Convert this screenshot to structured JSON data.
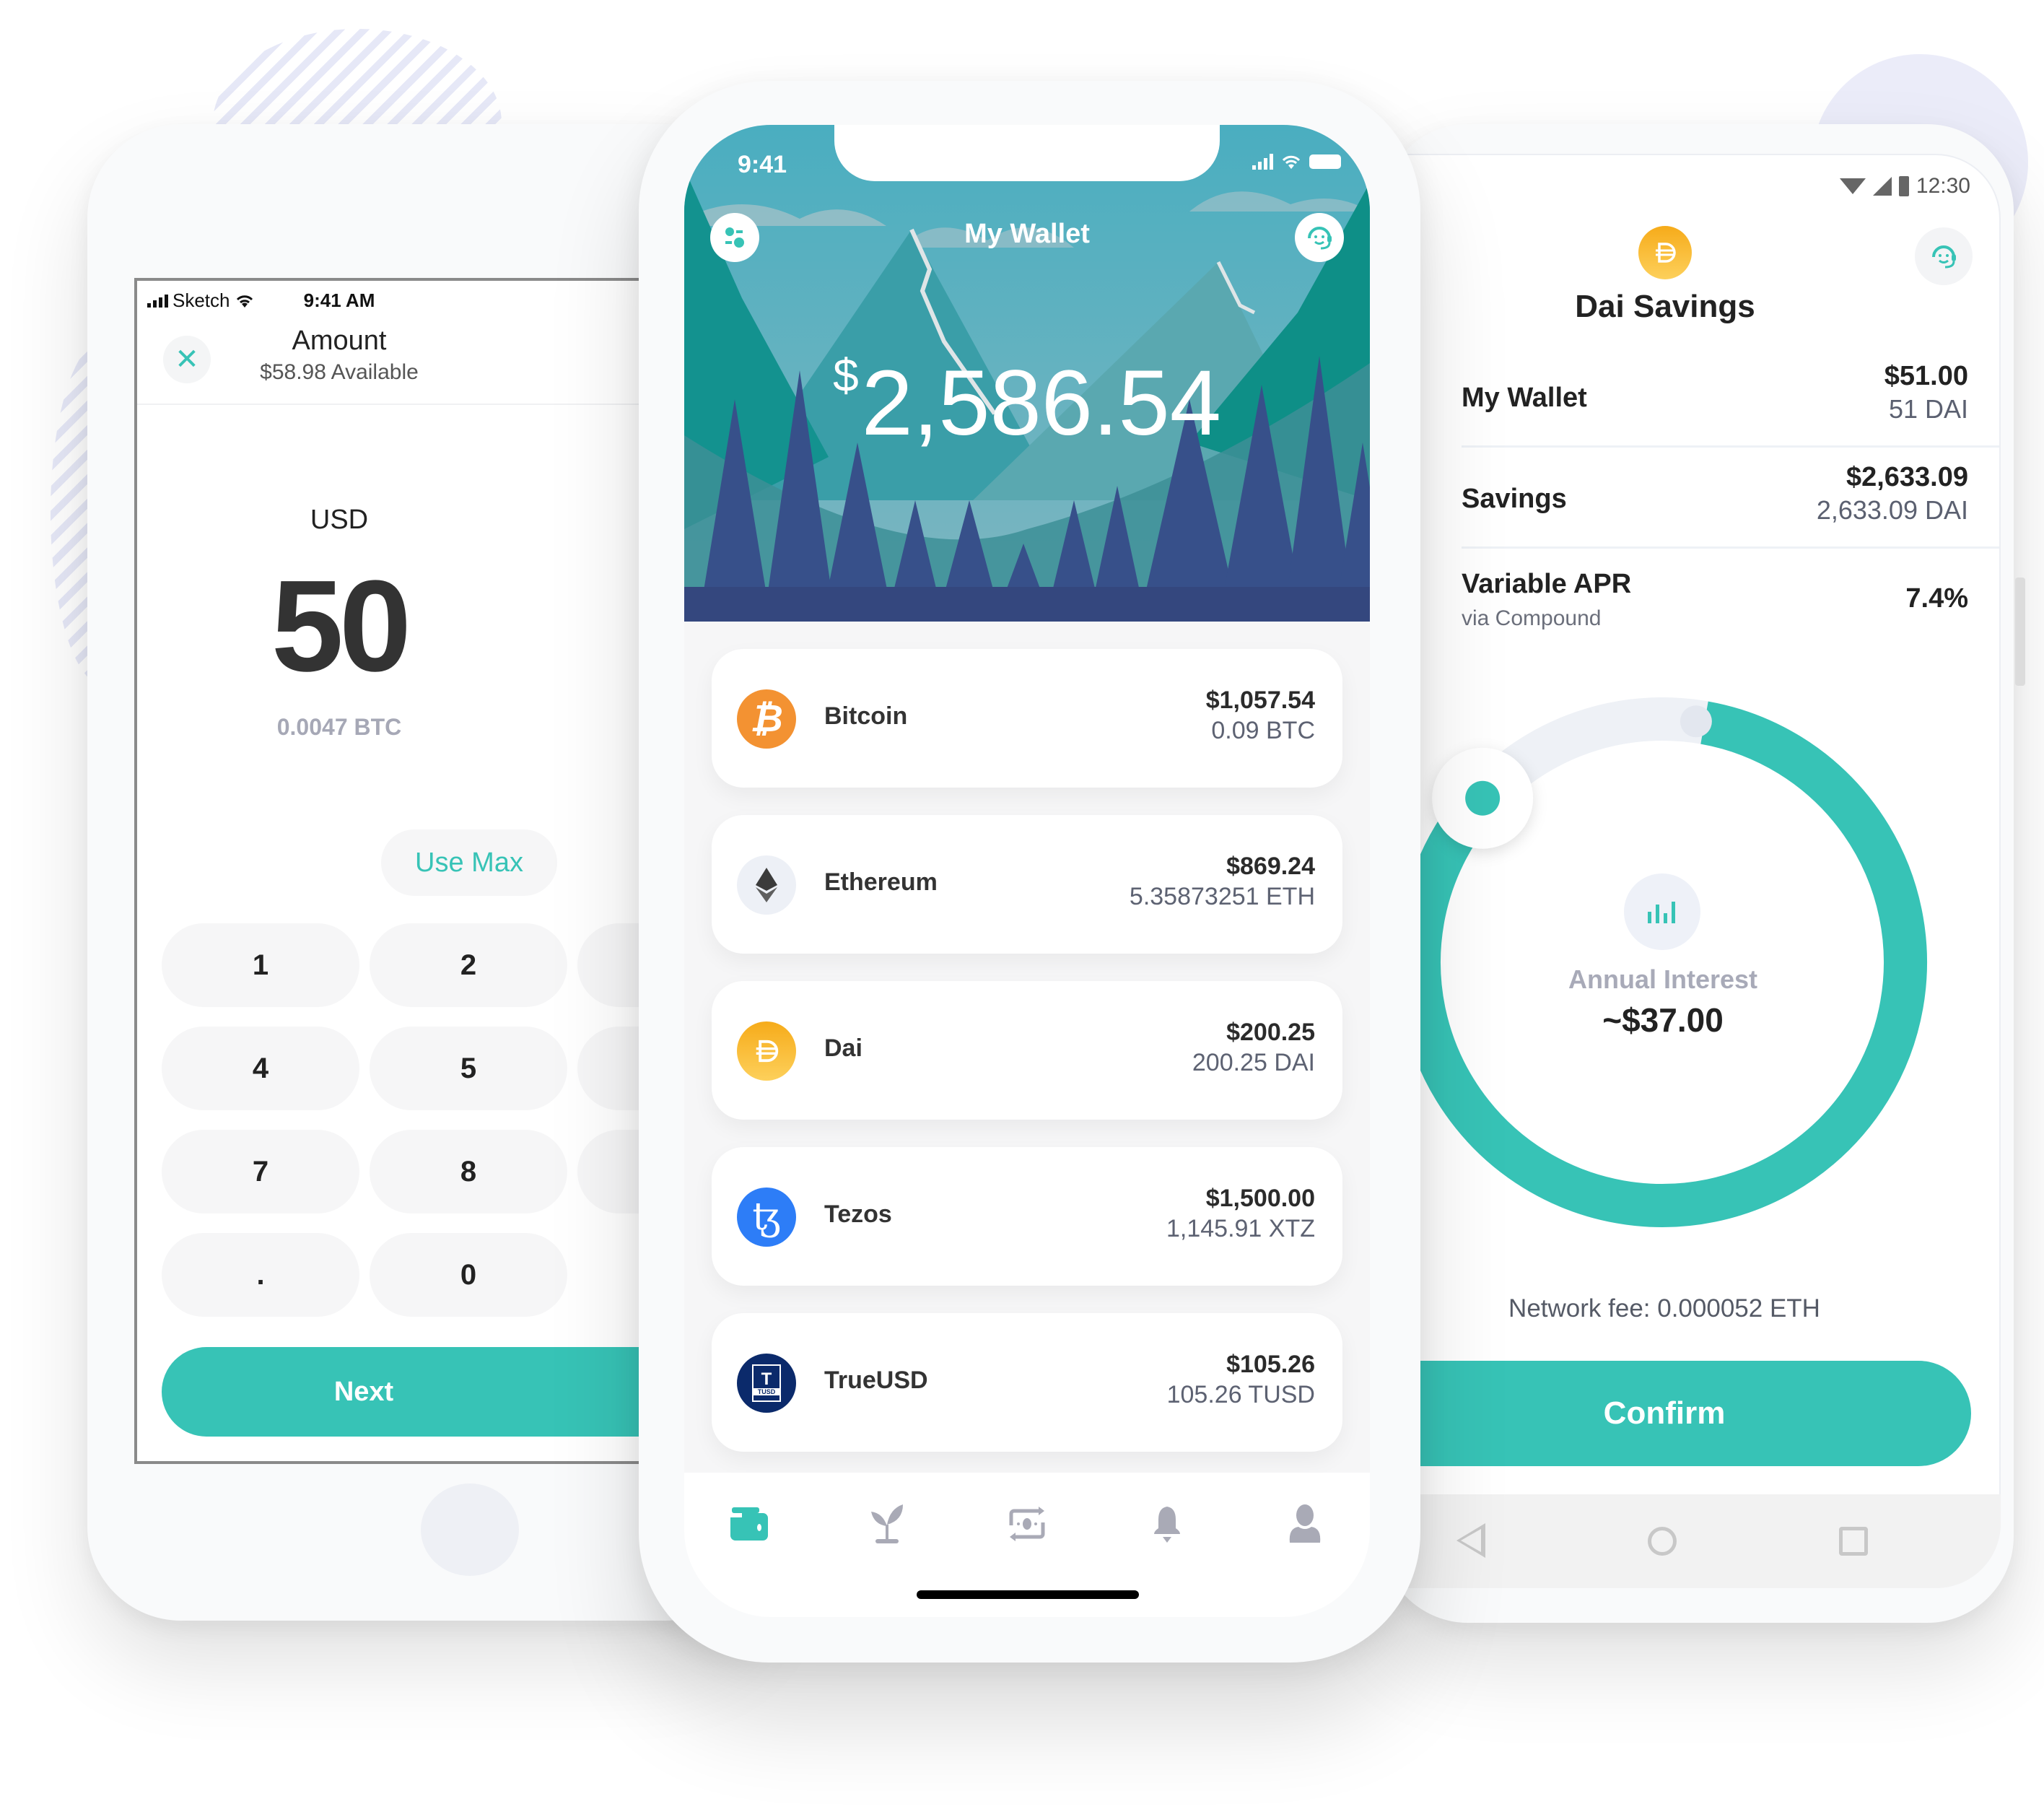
{
  "colors": {
    "accent": "#37c3b6",
    "inactive_icon": "#a9aab6",
    "bitcoin": "#f39232",
    "dai": "#f6b531",
    "tezos": "#2d7df7",
    "trueusd": "#0b2a6b"
  },
  "left_phone": {
    "status": {
      "carrier": "Sketch",
      "time": "9:41 AM"
    },
    "header": {
      "title": "Amount",
      "subtitle": "$58.98 Available",
      "close_icon": "close-icon"
    },
    "currency": "USD",
    "amount": "50",
    "converted": "0.0047 BTC",
    "use_max_label": "Use Max",
    "keypad": [
      "1",
      "2",
      "4",
      "5",
      "7",
      "8",
      ".",
      "0"
    ],
    "next_label": "Next"
  },
  "center_phone": {
    "status": {
      "time": "9:41"
    },
    "header": {
      "title": "My Wallet",
      "left_icon": "toggle-settings-icon",
      "right_icon": "support-agent-icon"
    },
    "balance": {
      "currency_symbol": "$",
      "amount": "2,586.54"
    },
    "assets": [
      {
        "name": "Bitcoin",
        "fiat": "$1,057.54",
        "amount": "0.09 BTC",
        "icon": "bitcoin-icon"
      },
      {
        "name": "Ethereum",
        "fiat": "$869.24",
        "amount": "5.35873251 ETH",
        "icon": "ethereum-icon"
      },
      {
        "name": "Dai",
        "fiat": "$200.25",
        "amount": "200.25 DAI",
        "icon": "dai-icon"
      },
      {
        "name": "Tezos",
        "fiat": "$1,500.00",
        "amount": "1,145.91 XTZ",
        "icon": "tezos-icon"
      },
      {
        "name": "TrueUSD",
        "fiat": "$105.26",
        "amount": "105.26 TUSD",
        "icon": "trueusd-icon",
        "badge_letter": "T",
        "badge_text": "TUSD"
      }
    ],
    "tabs": [
      {
        "name": "wallet",
        "icon": "wallet-icon",
        "active": true
      },
      {
        "name": "savings",
        "icon": "sprout-icon",
        "active": false
      },
      {
        "name": "exchange",
        "icon": "exchange-icon",
        "active": false
      },
      {
        "name": "notifications",
        "icon": "bell-icon",
        "active": false
      },
      {
        "name": "profile",
        "icon": "user-icon",
        "active": false
      }
    ]
  },
  "right_phone": {
    "status": {
      "time": "12:30"
    },
    "title": "Dai Savings",
    "rows": [
      {
        "label": "My Wallet",
        "value": "$51.00",
        "sub_value": "51 DAI"
      },
      {
        "label": "Savings",
        "value": "$2,633.09",
        "sub_value": "2,633.09 DAI"
      },
      {
        "label": "Variable APR",
        "sublabel": "via Compound",
        "value": "7.4%"
      }
    ],
    "savings_ring": {
      "filled_fraction": 0.84
    },
    "annual_interest": {
      "label": "Annual Interest",
      "value": "~$37.00"
    },
    "network_fee": "Network fee: 0.000052 ETH",
    "confirm_label": "Confirm"
  }
}
